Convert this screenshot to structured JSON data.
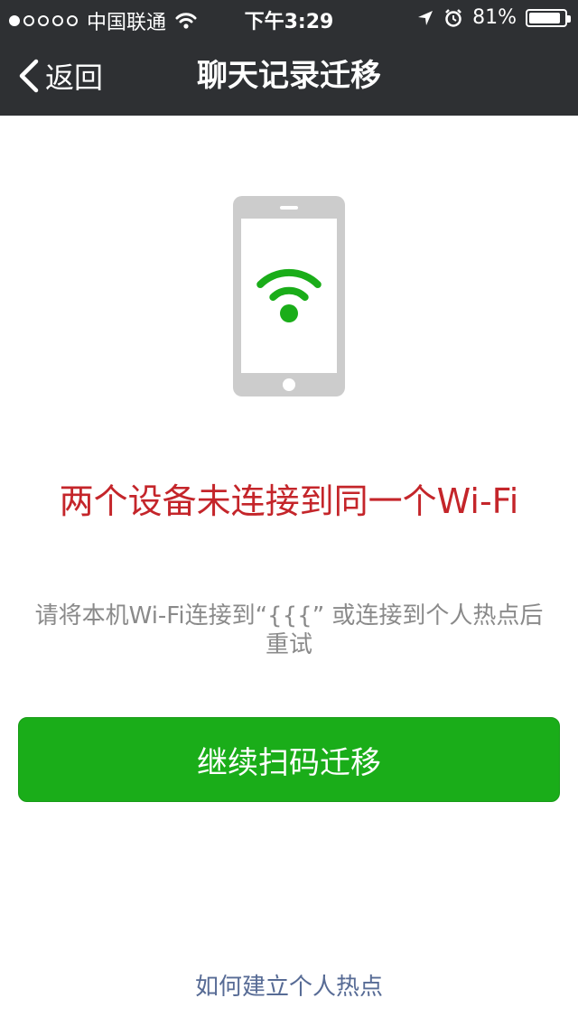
{
  "status_bar": {
    "signal_dots": {
      "filled": 1,
      "total": 5
    },
    "carrier": "中国联通",
    "time": "下午3:29",
    "battery_percent": "81%",
    "battery_level": 0.81,
    "icons": [
      "wifi-icon",
      "location-arrow-icon",
      "alarm-clock-icon",
      "battery-icon"
    ]
  },
  "nav": {
    "back_label": "返回",
    "title": "聊天记录迁移"
  },
  "illustration": {
    "icons": [
      "phone-icon",
      "wifi-icon"
    ],
    "accent_color": "#1aad19",
    "phone_color": "#cccccc"
  },
  "message": {
    "headline": "两个设备未连接到同一个Wi-Fi",
    "description": "请将本机Wi-Fi连接到“{{{” 或连接到个人热点后重试",
    "headline_color": "#c4252a"
  },
  "actions": {
    "continue_button": "继续扫码迁移",
    "hotspot_link": "如何建立个人热点"
  },
  "colors": {
    "nav_bar": "#2e3033",
    "primary_button": "#1aad19",
    "link": "#576b95"
  }
}
